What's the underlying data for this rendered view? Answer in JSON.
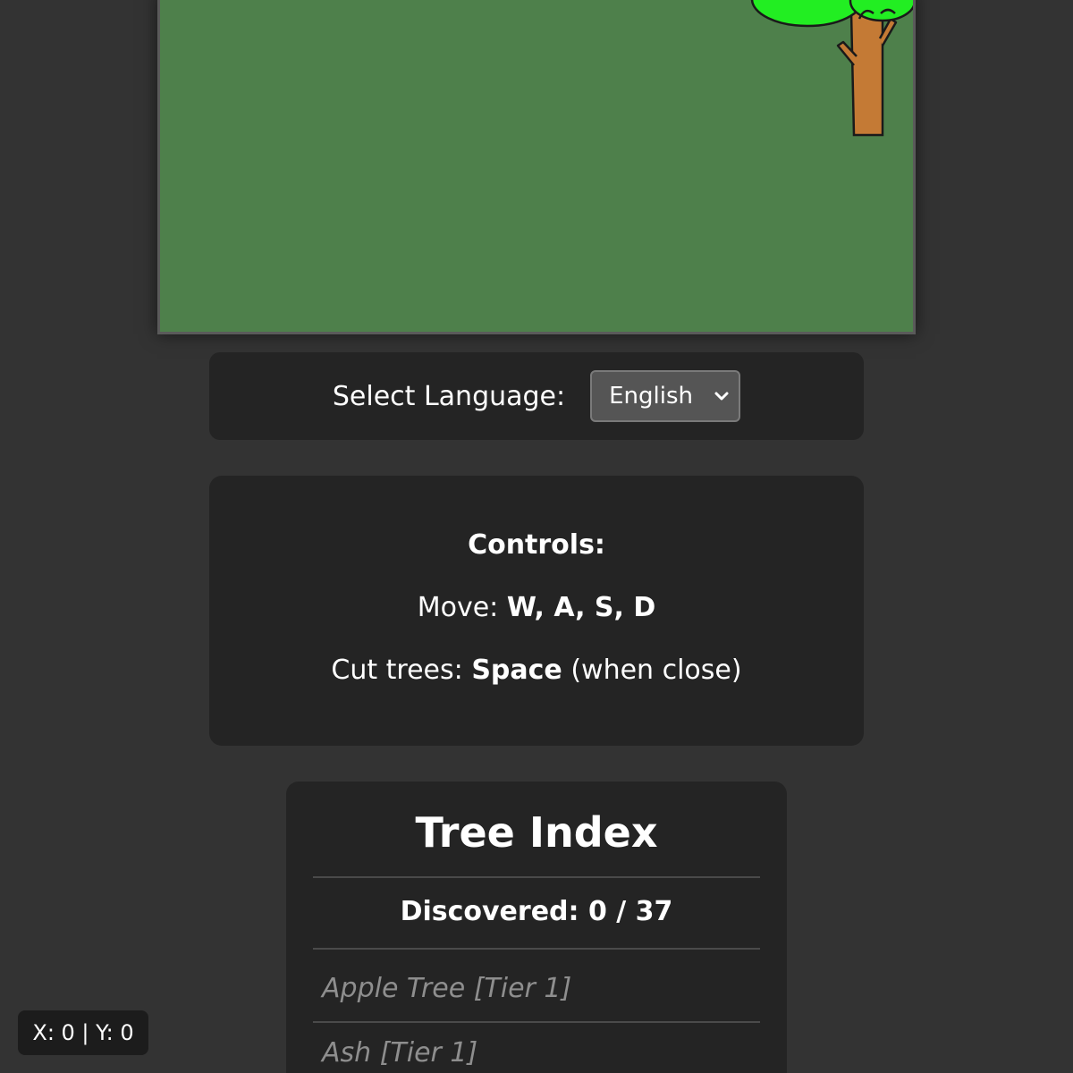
{
  "language": {
    "label": "Select Language:",
    "selected": "English"
  },
  "controls": {
    "title": "Controls:",
    "move_label": "Move:",
    "move_keys": "W, A, S, D",
    "cut_label": "Cut trees:",
    "cut_key": "Space",
    "cut_note": "(when close)"
  },
  "tree_index": {
    "title": "Tree Index",
    "discovered": "Discovered: 0 / 37",
    "items": [
      "Apple Tree [Tier 1]",
      "Ash [Tier 1]"
    ]
  },
  "coords": "X: 0 | Y: 0",
  "colors": {
    "grass": "#4e804b",
    "foliage": "#22ee22",
    "trunk": "#c47a35",
    "panel": "#242424",
    "background": "#333333"
  },
  "icons": {
    "select_chevron": "chevron-down-icon"
  }
}
